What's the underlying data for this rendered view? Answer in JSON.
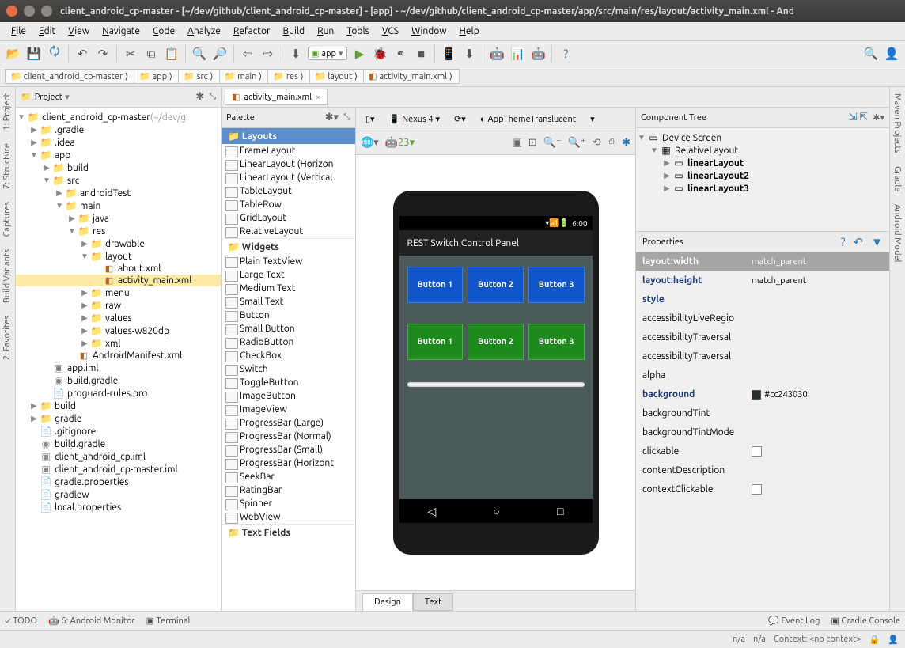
{
  "title": "client_android_cp-master - [~/dev/github/client_android_cp-master] - [app] - ~/dev/github/client_android_cp-master/app/src/main/res/layout/activity_main.xml - And",
  "menu": [
    "File",
    "Edit",
    "View",
    "Navigate",
    "Code",
    "Analyze",
    "Refactor",
    "Build",
    "Run",
    "Tools",
    "VCS",
    "Window",
    "Help"
  ],
  "breadcrumb": [
    "client_android_cp-master",
    "app",
    "src",
    "main",
    "res",
    "layout",
    "activity_main.xml"
  ],
  "run_config": "app",
  "project_panel": {
    "title": "Project"
  },
  "tree": [
    {
      "d": 0,
      "t": "▼",
      "i": "📁",
      "n": "client_android_cp-master",
      "suf": "(~/dev/g"
    },
    {
      "d": 1,
      "t": "▶",
      "i": "📁",
      "n": ".gradle"
    },
    {
      "d": 1,
      "t": "▶",
      "i": "📁",
      "n": ".idea"
    },
    {
      "d": 1,
      "t": "▼",
      "i": "📁",
      "n": "app"
    },
    {
      "d": 2,
      "t": "▶",
      "i": "📁",
      "n": "build"
    },
    {
      "d": 2,
      "t": "▼",
      "i": "📁",
      "n": "src"
    },
    {
      "d": 3,
      "t": "▶",
      "i": "📁",
      "n": "androidTest"
    },
    {
      "d": 3,
      "t": "▼",
      "i": "📁",
      "n": "main"
    },
    {
      "d": 4,
      "t": "▶",
      "i": "📁",
      "n": "java"
    },
    {
      "d": 4,
      "t": "▼",
      "i": "📁",
      "n": "res"
    },
    {
      "d": 5,
      "t": "▶",
      "i": "📁",
      "n": "drawable"
    },
    {
      "d": 5,
      "t": "▼",
      "i": "📁",
      "n": "layout"
    },
    {
      "d": 6,
      "t": "",
      "i": "◧",
      "n": "about.xml"
    },
    {
      "d": 6,
      "t": "",
      "i": "◧",
      "n": "activity_main.xml",
      "sel": true
    },
    {
      "d": 5,
      "t": "▶",
      "i": "📁",
      "n": "menu"
    },
    {
      "d": 5,
      "t": "▶",
      "i": "📁",
      "n": "raw"
    },
    {
      "d": 5,
      "t": "▶",
      "i": "📁",
      "n": "values"
    },
    {
      "d": 5,
      "t": "▶",
      "i": "📁",
      "n": "values-w820dp"
    },
    {
      "d": 5,
      "t": "▶",
      "i": "📁",
      "n": "xml"
    },
    {
      "d": 4,
      "t": "",
      "i": "◧",
      "n": "AndroidManifest.xml"
    },
    {
      "d": 2,
      "t": "",
      "i": "▣",
      "n": "app.iml"
    },
    {
      "d": 2,
      "t": "",
      "i": "◉",
      "n": "build.gradle"
    },
    {
      "d": 2,
      "t": "",
      "i": "📄",
      "n": "proguard-rules.pro"
    },
    {
      "d": 1,
      "t": "▶",
      "i": "📁",
      "n": "build"
    },
    {
      "d": 1,
      "t": "▶",
      "i": "📁",
      "n": "gradle"
    },
    {
      "d": 1,
      "t": "",
      "i": "📄",
      "n": ".gitignore"
    },
    {
      "d": 1,
      "t": "",
      "i": "◉",
      "n": "build.gradle"
    },
    {
      "d": 1,
      "t": "",
      "i": "▣",
      "n": "client_android_cp.iml"
    },
    {
      "d": 1,
      "t": "",
      "i": "▣",
      "n": "client_android_cp-master.iml"
    },
    {
      "d": 1,
      "t": "",
      "i": "📄",
      "n": "gradle.properties"
    },
    {
      "d": 1,
      "t": "",
      "i": "📄",
      "n": "gradlew"
    },
    {
      "d": 1,
      "t": "",
      "i": "📄",
      "n": "local.properties"
    }
  ],
  "editor_tab": "activity_main.xml",
  "palette_header": "Palette",
  "palette": {
    "group1": "Layouts",
    "items1": [
      "FrameLayout",
      "LinearLayout (Horizon",
      "LinearLayout (Vertical",
      "TableLayout",
      "TableRow",
      "GridLayout",
      "RelativeLayout"
    ],
    "group2": "Widgets",
    "items2": [
      "Plain TextView",
      "Large Text",
      "Medium Text",
      "Small Text",
      "Button",
      "Small Button",
      "RadioButton",
      "CheckBox",
      "Switch",
      "ToggleButton",
      "ImageButton",
      "ImageView",
      "ProgressBar (Large)",
      "ProgressBar (Normal)",
      "ProgressBar (Small)",
      "ProgressBar (Horizont",
      "SeekBar",
      "RatingBar",
      "Spinner",
      "WebView"
    ],
    "group3": "Text Fields"
  },
  "designer": {
    "device": "Nexus 4",
    "theme": "AppThemeTranslucent",
    "api": "23"
  },
  "phone": {
    "time": "6:00",
    "title": "REST Switch Control Panel",
    "row1": [
      "Button 1",
      "Button 2",
      "Button 3"
    ],
    "row2": [
      "Button 1",
      "Button 2",
      "Button 3"
    ]
  },
  "comp_tree_header": "Component Tree",
  "comp_tree": [
    {
      "d": 0,
      "t": "▼",
      "i": "▭",
      "n": "Device Screen"
    },
    {
      "d": 1,
      "t": "▼",
      "i": "▦",
      "n": "RelativeLayout"
    },
    {
      "d": 2,
      "t": "▶",
      "i": "▭",
      "n": "linearLayout",
      "b": true
    },
    {
      "d": 2,
      "t": "▶",
      "i": "▭",
      "n": "linearLayout2",
      "b": true
    },
    {
      "d": 2,
      "t": "▶",
      "i": "▭",
      "n": "linearLayout3",
      "b": true
    }
  ],
  "properties_header": "Properties",
  "properties": [
    {
      "n": "layout:width",
      "v": "match_parent",
      "sel": true,
      "bold": true
    },
    {
      "n": "layout:height",
      "v": "match_parent",
      "bold": true
    },
    {
      "n": "style",
      "v": "",
      "bold": true
    },
    {
      "n": "accessibilityLiveRegio",
      "v": ""
    },
    {
      "n": "accessibilityTraversal",
      "v": ""
    },
    {
      "n": "accessibilityTraversal",
      "v": ""
    },
    {
      "n": "alpha",
      "v": ""
    },
    {
      "n": "background",
      "v": "#cc243030",
      "bold": true,
      "swatch": "#243030"
    },
    {
      "n": "backgroundTint",
      "v": ""
    },
    {
      "n": "backgroundTintMode",
      "v": ""
    },
    {
      "n": "clickable",
      "v": "",
      "check": true
    },
    {
      "n": "contentDescription",
      "v": ""
    },
    {
      "n": "contextClickable",
      "v": "",
      "check": true
    }
  ],
  "design_tabs": [
    "Design",
    "Text"
  ],
  "bottom": {
    "todo": "TODO",
    "monitor": "6: Android Monitor",
    "terminal": "Terminal",
    "event": "Event Log",
    "gradle": "Gradle Console"
  },
  "status": {
    "na1": "n/a",
    "na2": "n/a",
    "ctx": "Context: <no context>"
  },
  "vstrips": {
    "left": [
      "1: Project",
      "7: Structure",
      "Captures",
      "Build Variants",
      "2: Favorites"
    ],
    "right": [
      "Maven Projects",
      "Gradle",
      "Android Model"
    ]
  }
}
